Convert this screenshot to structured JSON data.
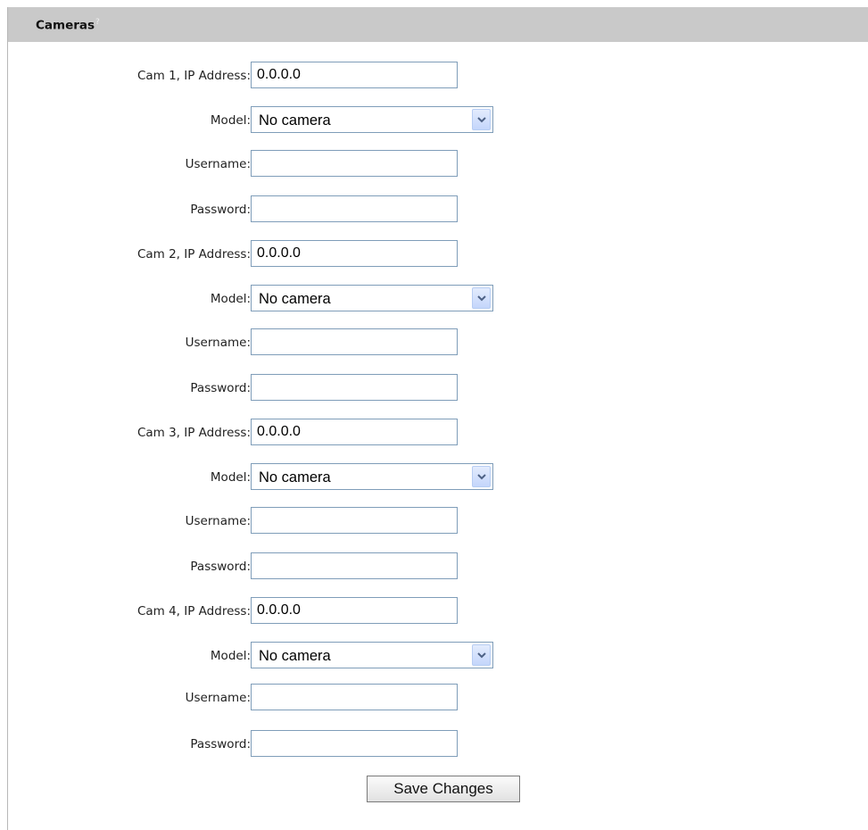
{
  "panel": {
    "title": "Cameras",
    "help_glyph": "?"
  },
  "cameras": [
    {
      "ip_label": "Cam 1, IP Address:",
      "ip_value": "0.0.0.0",
      "model_label": "Model:",
      "model_value": "No camera",
      "username_label": "Username:",
      "username_value": "",
      "password_label": "Password:",
      "password_value": ""
    },
    {
      "ip_label": "Cam 2, IP Address:",
      "ip_value": "0.0.0.0",
      "model_label": "Model:",
      "model_value": "No camera",
      "username_label": "Username:",
      "username_value": "",
      "password_label": "Password:",
      "password_value": ""
    },
    {
      "ip_label": "Cam 3, IP Address:",
      "ip_value": "0.0.0.0",
      "model_label": "Model:",
      "model_value": "No camera",
      "username_label": "Username:",
      "username_value": "",
      "password_label": "Password:",
      "password_value": ""
    },
    {
      "ip_label": "Cam 4, IP Address:",
      "ip_value": "0.0.0.0",
      "model_label": "Model:",
      "model_value": "No camera",
      "username_label": "Username:",
      "username_value": "",
      "password_label": "Password:",
      "password_value": ""
    }
  ],
  "save_label": "Save Changes",
  "colors": {
    "header_bg": "#c9c9c9",
    "input_border": "#7f9db9",
    "dropdown_button": "#c4d6fb"
  },
  "icons": {
    "help": "help-icon",
    "dropdown": "chevron-down-icon"
  }
}
